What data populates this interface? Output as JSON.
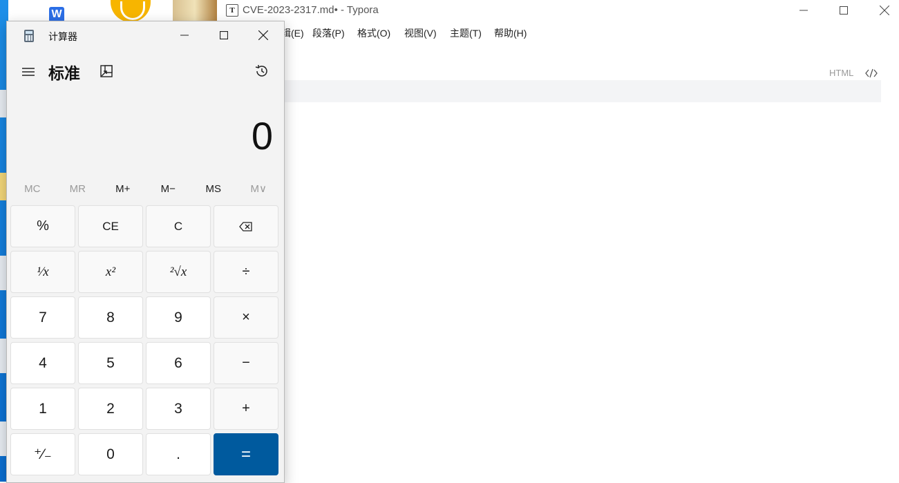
{
  "typora": {
    "title": "CVE-2023-2317.md• - Typora",
    "app_icon_letter": "T",
    "menu": [
      "辑(E)",
      "段落(P)",
      "格式(O)",
      "视图(V)",
      "主题(T)",
      "帮助(H)"
    ],
    "code_lang": "HTML"
  },
  "calculator": {
    "title": "计算器",
    "mode": "标准",
    "display": "0",
    "memory": [
      {
        "label": "MC",
        "enabled": false
      },
      {
        "label": "MR",
        "enabled": false
      },
      {
        "label": "M+",
        "enabled": true
      },
      {
        "label": "M−",
        "enabled": true
      },
      {
        "label": "MS",
        "enabled": true
      },
      {
        "label": "M∨",
        "enabled": false
      }
    ],
    "keys": {
      "percent": "%",
      "ce": "CE",
      "c": "C",
      "reciprocal": "¹⁄x",
      "square": "x²",
      "sqrt": "²√x",
      "divide": "÷",
      "seven": "7",
      "eight": "8",
      "nine": "9",
      "multiply": "×",
      "four": "4",
      "five": "5",
      "six": "6",
      "minus": "−",
      "one": "1",
      "two": "2",
      "three": "3",
      "plus": "+",
      "negate": "⁺⁄₋",
      "zero": "0",
      "decimal": ".",
      "equals": "="
    }
  },
  "icons": {
    "backspace": "backspace-icon",
    "history": "history-icon",
    "keep_on_top": "keep-on-top-icon",
    "menu": "hamburger-menu-icon",
    "code": "code-brackets-icon"
  },
  "colors": {
    "equals_key": "#005a9e",
    "desktop": "#1d8fe8"
  }
}
